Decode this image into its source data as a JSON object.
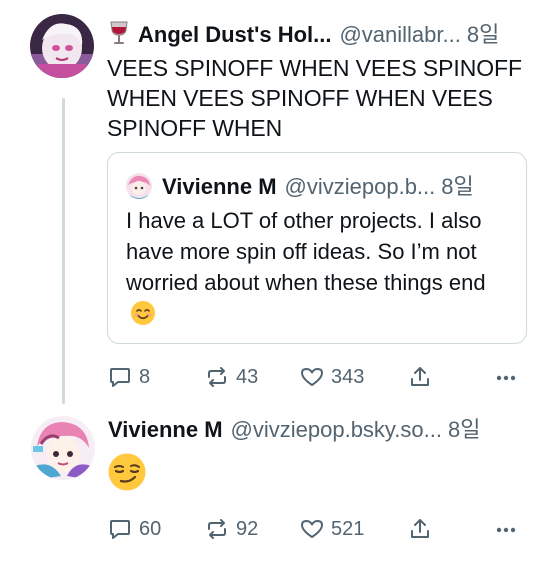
{
  "post1": {
    "author_prefix_icon": "wine-glass-icon",
    "display_name": "Angel Dust's Hol...",
    "handle": "@vanillabr...",
    "time": "8일",
    "text": "VEES SPINOFF WHEN VEES SPINOFF WHEN VEES SPINOFF WHEN VEES SPINOFF WHEN",
    "quote": {
      "display_name": "Vivienne M",
      "handle": "@vivziepop.b...",
      "time": "8일",
      "text": "I have a LOT of other projects. I also have more spin off ideas. So I’m not worried about when these things end",
      "trailing_emoji": "smiling-face-with-smiling-eyes-emoji"
    },
    "actions": {
      "replies": "8",
      "reposts": "43",
      "likes": "343"
    }
  },
  "post2": {
    "display_name": "Vivienne M",
    "handle": "@vivziepop.bsky.so...",
    "time": "8일",
    "emoji": "smirking-face-emoji",
    "actions": {
      "replies": "60",
      "reposts": "92",
      "likes": "521"
    }
  },
  "colors": {
    "text": "#0f1419",
    "muted": "#536471",
    "border": "#cfd9de"
  }
}
